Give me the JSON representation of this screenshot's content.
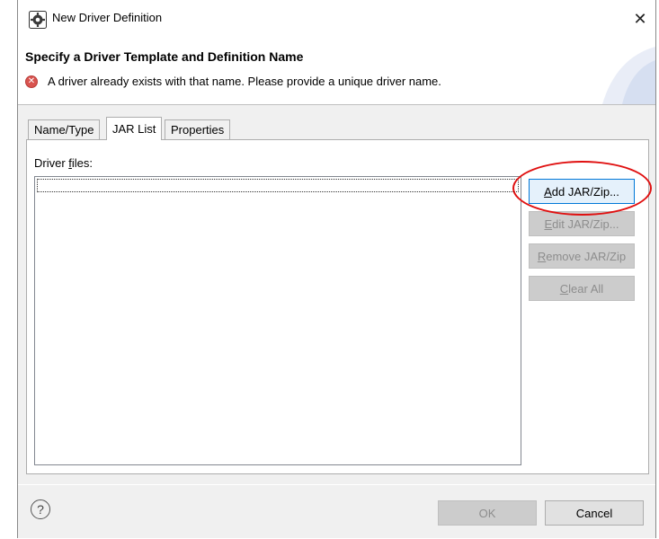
{
  "window": {
    "title": "New Driver Definition",
    "close_glyph": "✕"
  },
  "header": {
    "heading": "Specify a Driver Template and Definition Name",
    "error_message": "A driver already exists with that name. Please provide a unique driver name.",
    "error_glyph": "✕"
  },
  "tabs": [
    {
      "label": "Name/Type",
      "selected": false
    },
    {
      "label": "JAR List",
      "selected": true
    },
    {
      "label": "Properties",
      "selected": false
    }
  ],
  "jar_list": {
    "label_prefix": "Driver ",
    "label_mnemonic": "f",
    "label_suffix": "iles:",
    "files": []
  },
  "buttons": {
    "add": {
      "mn": "A",
      "rest": "dd JAR/Zip...",
      "enabled": true
    },
    "edit": {
      "mn": "E",
      "rest": "dit JAR/Zip...",
      "enabled": false
    },
    "remove": {
      "mn": "R",
      "rest": "emove JAR/Zip",
      "enabled": false
    },
    "clear": {
      "mn": "C",
      "rest": "lear All",
      "enabled": false
    }
  },
  "footer": {
    "help_glyph": "?",
    "ok_label": "OK",
    "ok_enabled": false,
    "cancel_label": "Cancel"
  },
  "icons": {
    "app": "driver-gear-icon",
    "error": "error-icon",
    "help": "help-icon",
    "close": "close-icon"
  },
  "colors": {
    "error_red": "#d9534f",
    "highlight": "#e01010",
    "primary_border": "#0078d7"
  }
}
